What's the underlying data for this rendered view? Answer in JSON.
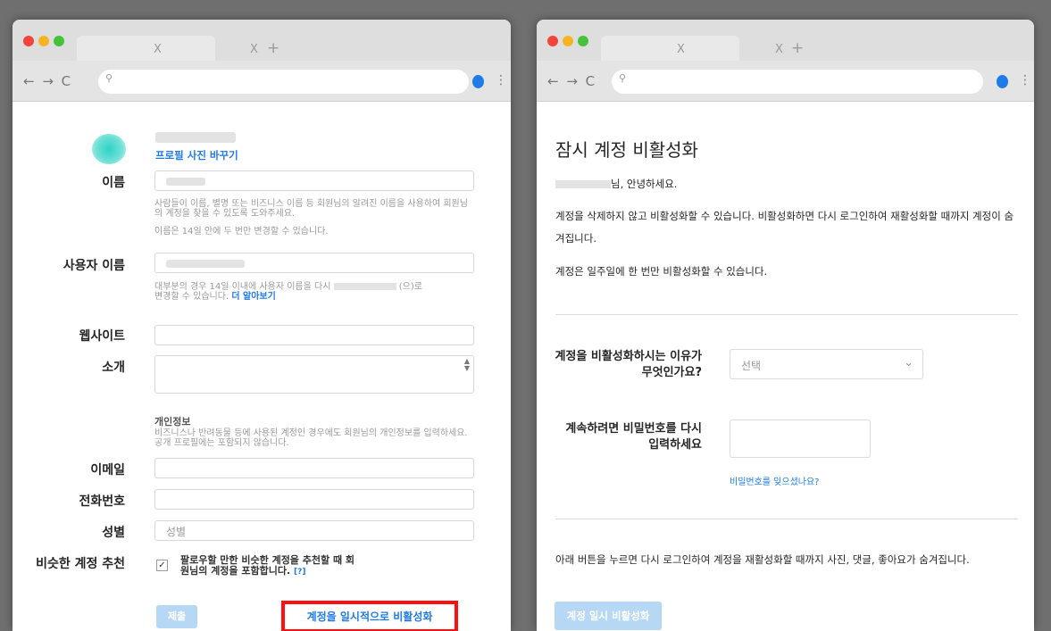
{
  "browser": {
    "tab_close": "X",
    "new_tab": "+",
    "nav_buttons": "← → C",
    "search_icon": "⚲",
    "menu": "⋮"
  },
  "edit_profile": {
    "change_photo": "프로필 사진 바꾸기",
    "name_label": "이름",
    "name_help": "사람들이 이름, 별명 또는 비즈니스 이름 등 회원님의 알려진 이름을 사용하여 회원님의 계정을 찾을 수 있도록 도와주세요.",
    "name_limit": "이름은 14일 안에 두 번만 변경할 수 있습니다.",
    "username_label": "사용자 이름",
    "username_help_pre": "대부분의 경우 14일 이내에 사용자 이름을 다시",
    "username_help_suffix": "(으)로",
    "username_help_post": "변경할 수 있습니다.",
    "learn_more": "더 알아보기",
    "website_label": "웹사이트",
    "bio_label": "소개",
    "personal_info_title": "개인정보",
    "personal_info_help": "비즈니스나 반려동물 등에 사용된 계정인 경우에도 회원님의 개인정보를 입력하세요. 공개 프로필에는 포함되지 않습니다.",
    "email_label": "이메일",
    "phone_label": "전화번호",
    "gender_label": "성별",
    "gender_placeholder": "성별",
    "suggestions_label": "비슷한 계정 추천",
    "suggestions_text": "팔로우할 만한 비슷한 계정을 추천할 때 회원님의 계정을 포함합니다.",
    "suggestions_help": "[?]",
    "checkbox_mark": "✓",
    "submit": "제출",
    "deactivate_link": "계정을 일시적으로 비활성화"
  },
  "deactivate_page": {
    "title": "잠시 계정 비활성화",
    "greeting": "님, 안녕하세요.",
    "para1": "계정을 삭제하지 않고 비활성화할 수 있습니다. 비활성화하면 다시 로그인하여 재활성화할 때까지 계정이 숨겨집니다.",
    "para2": "계정은 일주일에 한 번만 비활성화할 수 있습니다.",
    "reason_label": "계정을 비활성화하시는 이유가 무엇인가요?",
    "select_placeholder": "선택",
    "password_label": "계속하려면 비밀번호를 다시 입력하세요",
    "forgot_password": "비밀번호를 잊으셨나요?",
    "bottom_note": "아래 버튼을 누르면 다시 로그인하여 계정을 재활성화할 때까지 사진, 댓글, 좋아요가 숨겨집니다.",
    "deactivate_button": "계정 일시 비활성화"
  }
}
